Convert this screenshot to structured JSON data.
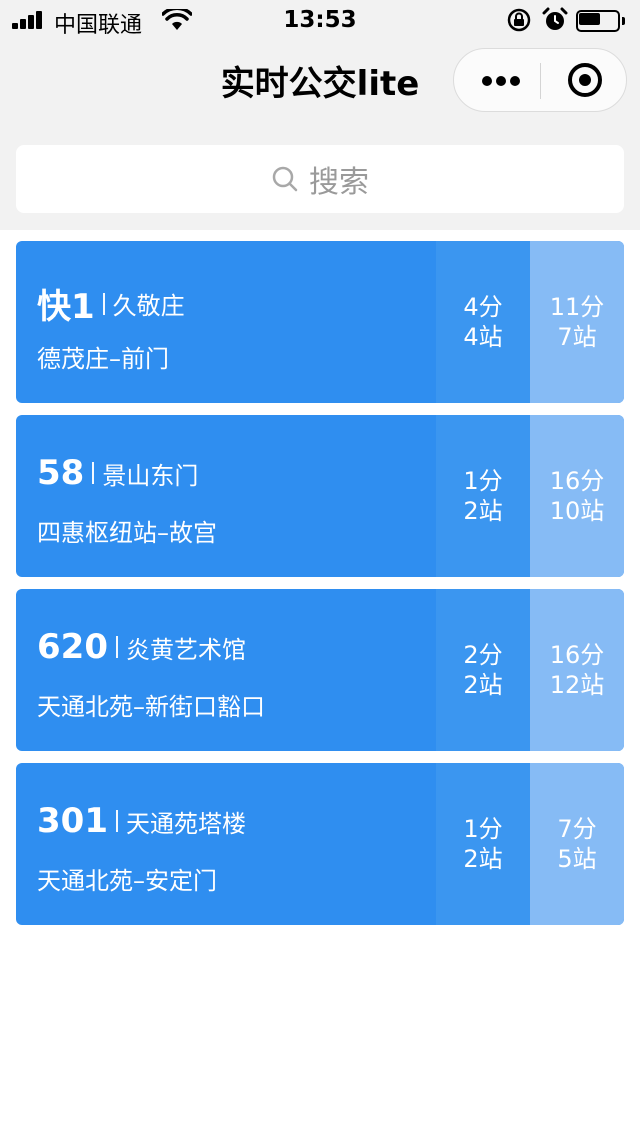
{
  "status_bar": {
    "carrier": "中国联通",
    "time": "13:53",
    "battery_level": 0.55
  },
  "nav": {
    "title": "实时公交lite"
  },
  "search": {
    "placeholder": "搜索"
  },
  "colors": {
    "card_primary": "#2f8ef0",
    "eta_first": "#3b96f0",
    "eta_second": "#86bbf5"
  },
  "routes": [
    {
      "name": "快1",
      "stop": "久敬庄",
      "direction": "德茂庄–前门",
      "eta1_time": "4分",
      "eta1_stops": "4站",
      "eta2_time": "11分",
      "eta2_stops": "7站"
    },
    {
      "name": "58",
      "stop": "景山东门",
      "direction": "四惠枢纽站–故宫",
      "eta1_time": "1分",
      "eta1_stops": "2站",
      "eta2_time": "16分",
      "eta2_stops": "10站"
    },
    {
      "name": "620",
      "stop": "炎黄艺术馆",
      "direction": "天通北苑–新街口豁口",
      "eta1_time": "2分",
      "eta1_stops": "2站",
      "eta2_time": "16分",
      "eta2_stops": "12站"
    },
    {
      "name": "301",
      "stop": "天通苑塔楼",
      "direction": "天通北苑–安定门",
      "eta1_time": "1分",
      "eta1_stops": "2站",
      "eta2_time": "7分",
      "eta2_stops": "5站"
    }
  ]
}
